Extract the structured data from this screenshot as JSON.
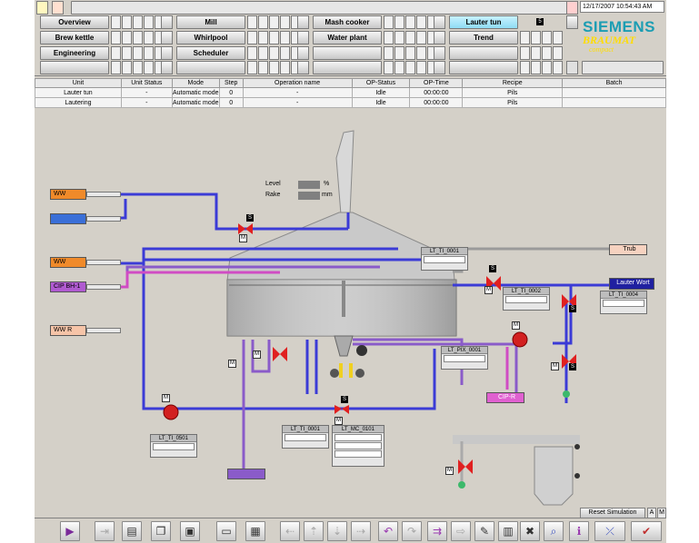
{
  "header": {
    "datetime": "12/17/2007 10:54:43 AM",
    "buttons": {
      "overview": "Overview",
      "brew_kettle": "Brew kettle",
      "engineering": "Engineering",
      "mill": "Mill",
      "whirlpool": "Whirlpool",
      "scheduler": "Scheduler",
      "mash_cooker": "Mash cooker",
      "water_plant": "Water plant",
      "lauter_tun": "Lauter tun",
      "trend": "Trend"
    },
    "lauter_badge": "5",
    "brand": {
      "name": "SIEMENS",
      "product": "BRAUMAT",
      "edition": "compact"
    }
  },
  "unit_table": {
    "columns": [
      "Unit",
      "Unit Status",
      "Mode",
      "Step",
      "Operation name",
      "OP-Status",
      "OP-Time",
      "Recipe",
      "Batch"
    ],
    "rows": [
      [
        "Lauter tun",
        "-",
        "Automatic mode",
        "0",
        "-",
        "Idle",
        "00:00:00",
        "Pils",
        ""
      ],
      [
        "Lautering",
        "-",
        "Automatic mode",
        "0",
        "-",
        "Idle",
        "00:00:00",
        "Pils",
        ""
      ]
    ]
  },
  "process": {
    "level_label": "Level",
    "level_unit": "%",
    "rake_label": "Rake",
    "rake_unit": "mm",
    "inlets": {
      "ww1": "WW",
      "ww2": "WW",
      "ww3": "WW",
      "cip": "CIP BH-1",
      "wwr": "WW R"
    },
    "outlets": {
      "trub": "Trub",
      "lauter_wort": "Lauter Wort",
      "cip_r": "CIP-R"
    },
    "panels": {
      "p1": "LT_TI_0001",
      "p2": "LT_TI_0002",
      "p3": "LT_TI_0004",
      "p4": "LT_PIX_0001",
      "p5": "LT_TI_0501",
      "p6": "LT_TI_0001",
      "p7": "LT_MC_0101"
    },
    "m_label": "M",
    "s_label": "S"
  },
  "footer": {
    "reset_simulation": "Reset Simulation",
    "a_label": "A",
    "m_label": "M"
  },
  "colors": {
    "pipe_blue": "#3b3bd6",
    "pipe_violet": "#8a5bc9",
    "pipe_pink": "#d04cc4",
    "valve_red": "#e02020",
    "tag_orange": "#f08a2a",
    "tag_blue": "#3a6fd8",
    "tag_purple": "#b05ad0",
    "tag_salmon": "#f6c4a8",
    "lauter_wort": "#2020a0",
    "cip_r": "#e060d0"
  }
}
